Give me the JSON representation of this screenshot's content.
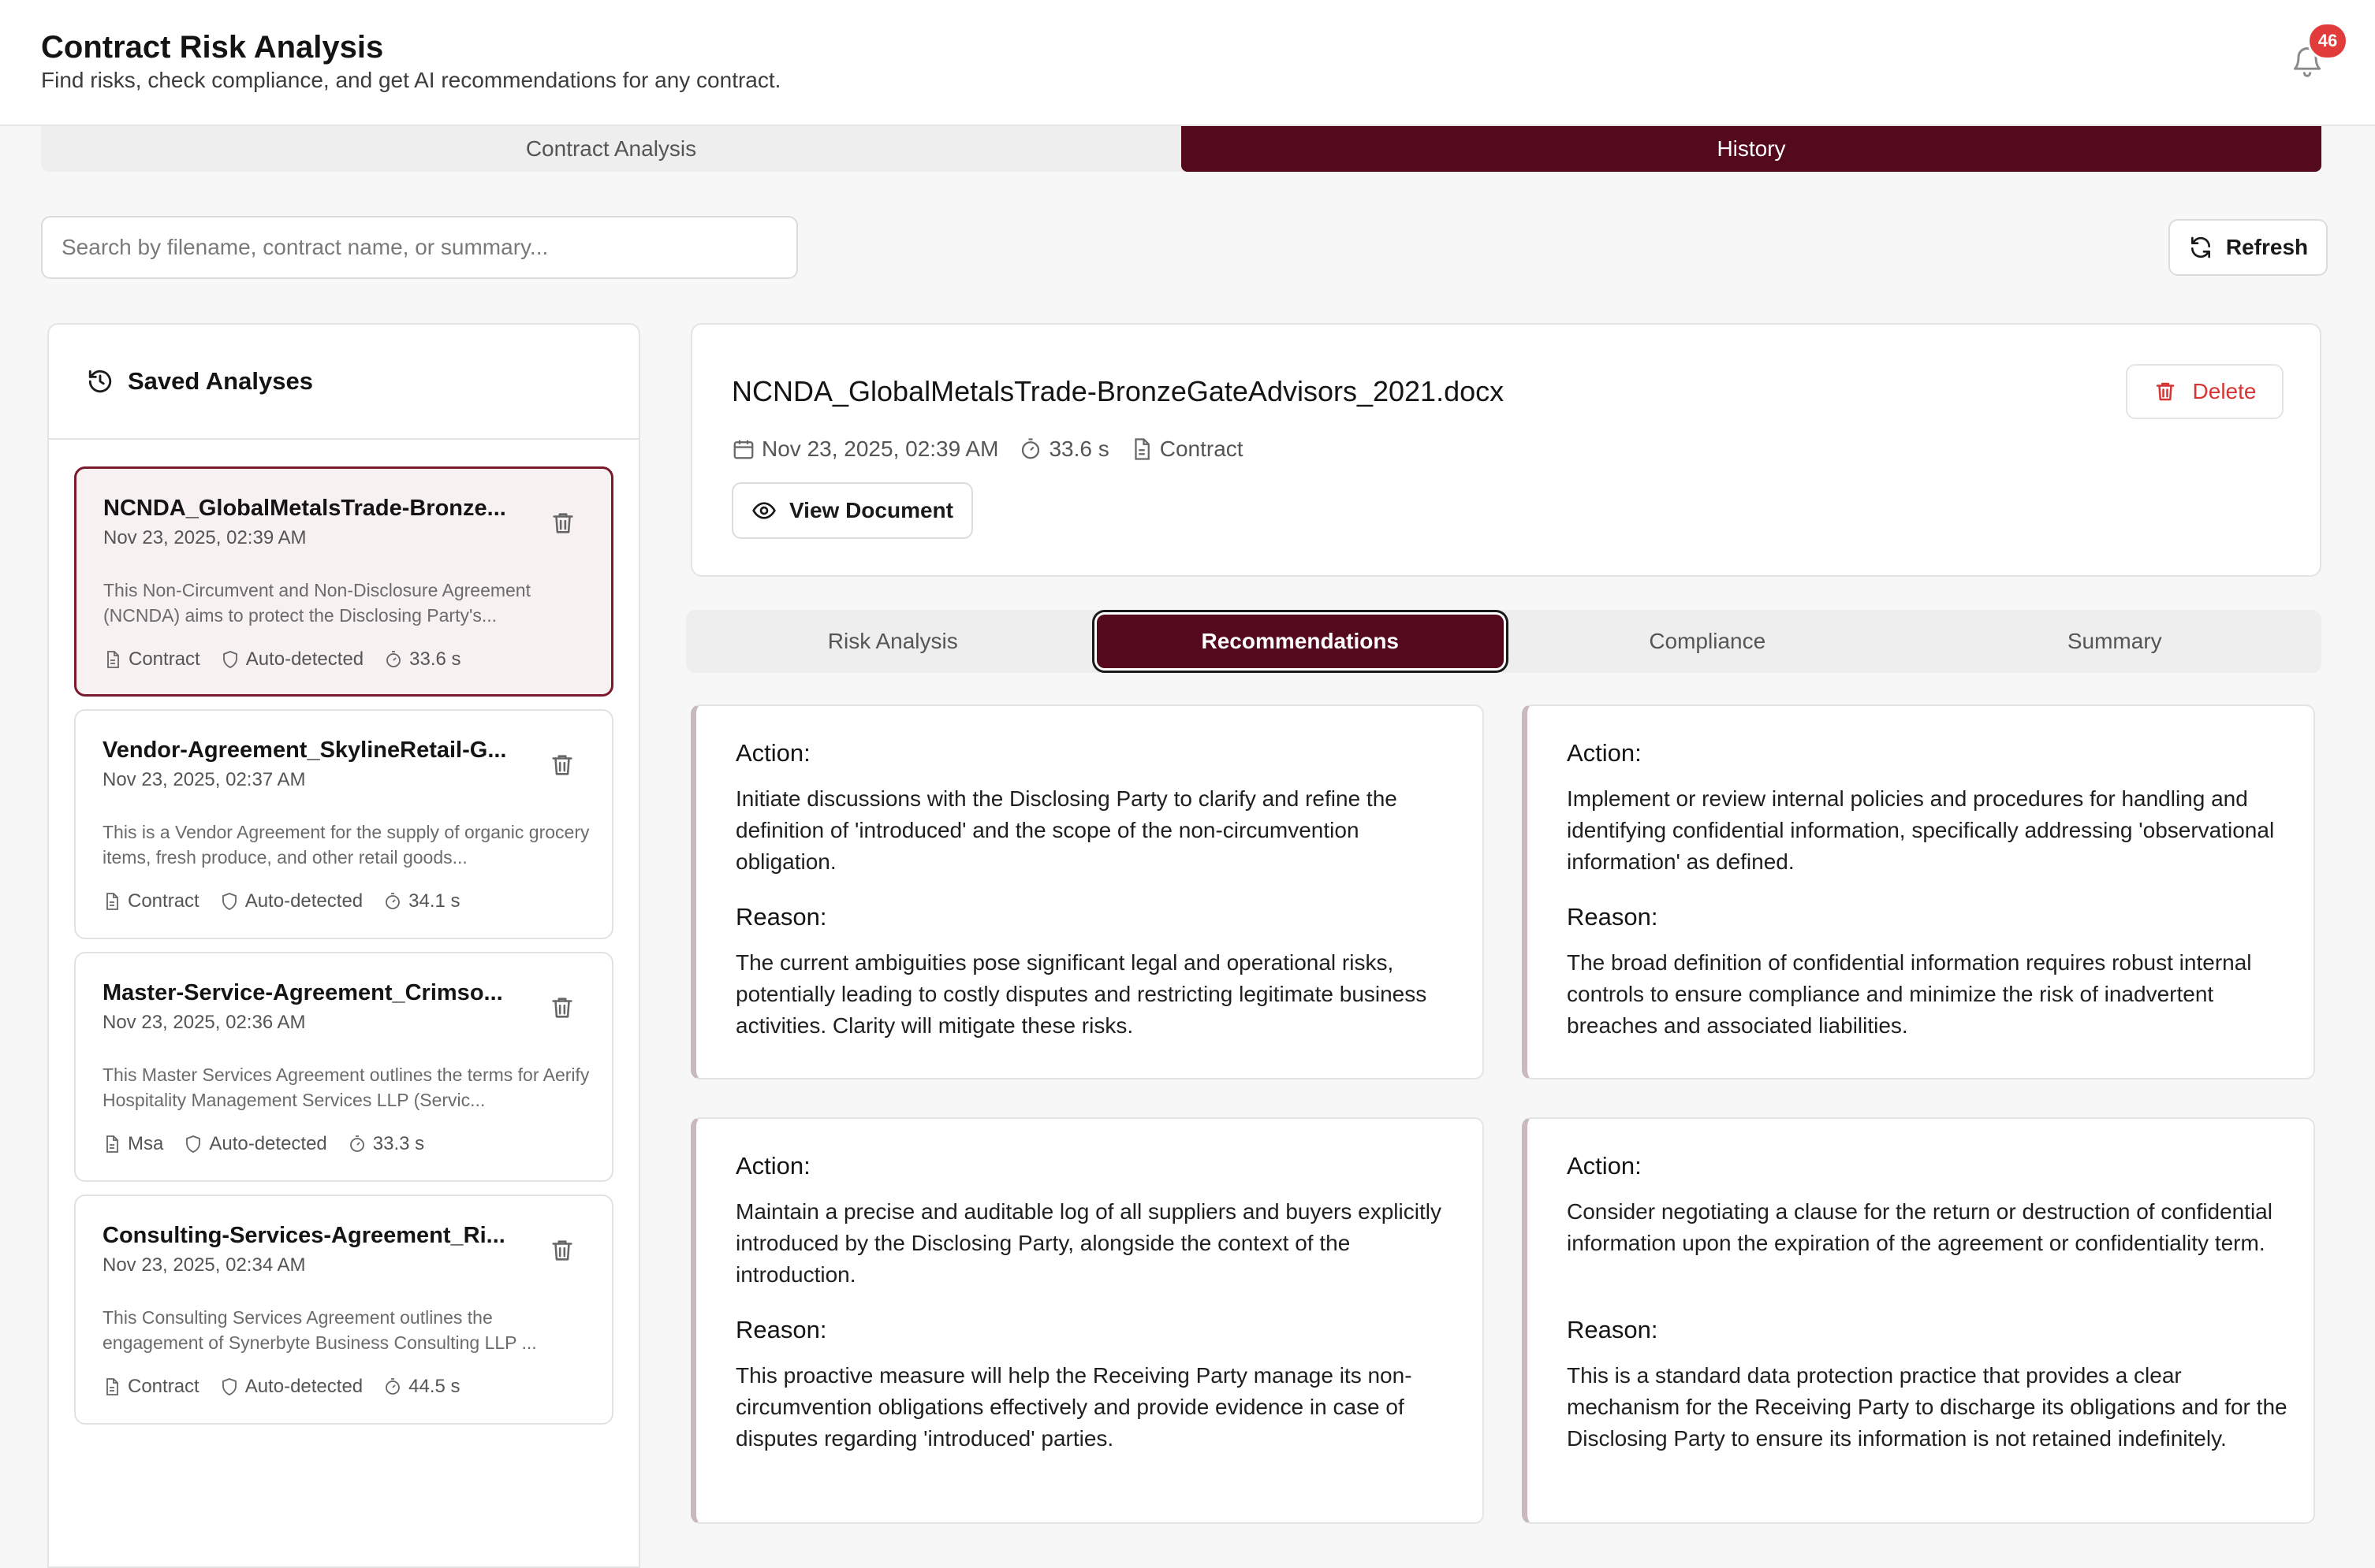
{
  "header": {
    "title": "Contract Risk Analysis",
    "subtitle": "Find risks, check compliance, and get AI recommendations for any contract.",
    "notification_count": "46"
  },
  "main_tabs": [
    {
      "label": "Contract Analysis",
      "active": false
    },
    {
      "label": "History",
      "active": true
    }
  ],
  "search": {
    "placeholder": "Search by filename, contract name, or summary...",
    "value": ""
  },
  "refresh_label": "Refresh",
  "sidebar": {
    "title": "Saved Analyses",
    "items": [
      {
        "name": "NCNDA_GlobalMetalsTrade-Bronze...",
        "date": "Nov 23, 2025, 02:39 AM",
        "summary": "This Non-Circumvent and Non-Disclosure Agreement (NCNDA) aims to protect the Disclosing Party's...",
        "type": "Contract",
        "detection": "Auto-detected",
        "duration": "33.6 s",
        "selected": true
      },
      {
        "name": "Vendor-Agreement_SkylineRetail-G...",
        "date": "Nov 23, 2025, 02:37 AM",
        "summary": "This is a Vendor Agreement for the supply of organic grocery items, fresh produce, and other retail goods...",
        "type": "Contract",
        "detection": "Auto-detected",
        "duration": "34.1 s",
        "selected": false
      },
      {
        "name": "Master-Service-Agreement_Crimso...",
        "date": "Nov 23, 2025, 02:36 AM",
        "summary": "This Master Services Agreement outlines the terms for Aerify Hospitality Management Services LLP (Servic...",
        "type": "Msa",
        "detection": "Auto-detected",
        "duration": "33.3 s",
        "selected": false
      },
      {
        "name": "Consulting-Services-Agreement_Ri...",
        "date": "Nov 23, 2025, 02:34 AM",
        "summary": "This Consulting Services Agreement outlines the engagement of Synerbyte Business Consulting LLP ...",
        "type": "Contract",
        "detection": "Auto-detected",
        "duration": "44.5 s",
        "selected": false
      }
    ]
  },
  "document": {
    "title": "NCNDA_GlobalMetalsTrade-BronzeGateAdvisors_2021.docx",
    "date": "Nov 23, 2025, 02:39 AM",
    "duration": "33.6 s",
    "type": "Contract",
    "delete_label": "Delete",
    "view_label": "View Document"
  },
  "sub_tabs": [
    {
      "label": "Risk Analysis",
      "active": false
    },
    {
      "label": "Recommendations",
      "active": true
    },
    {
      "label": "Compliance",
      "active": false
    },
    {
      "label": "Summary",
      "active": false
    }
  ],
  "recommendations": [
    {
      "action_label": "Action:",
      "action": "Initiate discussions with the Disclosing Party to clarify and refine the definition of 'introduced' and the scope of the non-circumvention obligation.",
      "reason_label": "Reason:",
      "reason": "The current ambiguities pose significant legal and operational risks, potentially leading to costly disputes and restricting legitimate business activities. Clarity will mitigate these risks."
    },
    {
      "action_label": "Action:",
      "action": "Implement or review internal policies and procedures for handling and identifying confidential information, specifically addressing 'observational information' as defined.",
      "reason_label": "Reason:",
      "reason": "The broad definition of confidential information requires robust internal controls to ensure compliance and minimize the risk of inadvertent breaches and associated liabilities."
    },
    {
      "action_label": "Action:",
      "action": "Maintain a precise and auditable log of all suppliers and buyers explicitly introduced by the Disclosing Party, alongside the context of the introduction.",
      "reason_label": "Reason:",
      "reason": "This proactive measure will help the Receiving Party manage its non-circumvention obligations effectively and provide evidence in case of disputes regarding 'introduced' parties."
    },
    {
      "action_label": "Action:",
      "action": "Consider negotiating a clause for the return or destruction of confidential information upon the expiration of the agreement or confidentiality term.",
      "reason_label": "Reason:",
      "reason": "This is a standard data protection practice that provides a clear mechanism for the Receiving Party to discharge its obligations and for the Disclosing Party to ensure its information is not retained indefinitely."
    }
  ],
  "colors": {
    "accent": "#540a1c",
    "selected_border": "#7a1a2c",
    "danger": "#d63434",
    "badge": "#e23b3b"
  }
}
